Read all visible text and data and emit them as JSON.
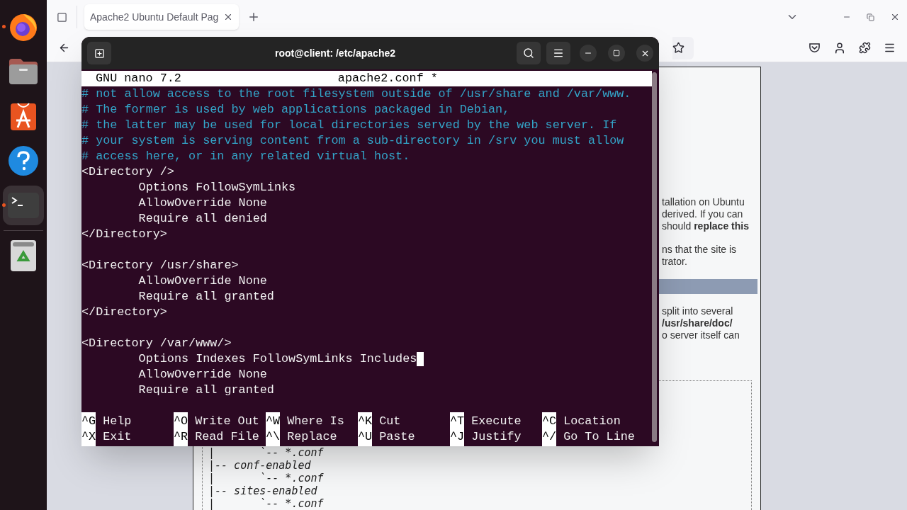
{
  "browser": {
    "tab": {
      "title": "Apache2 Ubuntu Default Pag",
      "selected": true
    },
    "page_lines": [
      {
        "kind": "text",
        "text": "tallation on Ubuntu"
      },
      {
        "kind": "text",
        "text": "derived. If you can"
      },
      {
        "kind": "text",
        "text": "should **replace this**"
      },
      {
        "kind": "gap"
      },
      {
        "kind": "text",
        "text": "ns that the site is"
      },
      {
        "kind": "text",
        "text": "trator."
      },
      {
        "kind": "gap"
      },
      {
        "kind": "bar"
      },
      {
        "kind": "gap"
      },
      {
        "kind": "text",
        "text": "split into several"
      },
      {
        "kind": "text",
        "text": "**/usr/share/doc/**"
      },
      {
        "kind": "text",
        "text": "o server itself can"
      }
    ],
    "tree": [
      "|       `-- *.conf",
      "|-- conf-enabled",
      "|       `-- *.conf",
      "|-- sites-enabled",
      "|       `-- *.conf"
    ]
  },
  "terminal": {
    "title": "root@client: /etc/apache2",
    "editor": "GNU nano 7.2",
    "file": "apache2.conf *",
    "lines": [
      {
        "kind": "comment",
        "text": "# not allow access to the root filesystem outside of /usr/share and /var/www.",
        "cursor": false
      },
      {
        "kind": "comment",
        "text": "# The former is used by web applications packaged in Debian,",
        "cursor": false
      },
      {
        "kind": "comment",
        "text": "# the latter may be used for local directories served by the web server. If",
        "cursor": false
      },
      {
        "kind": "comment",
        "text": "# your system is serving content from a sub-directory in /srv you must allow",
        "cursor": false
      },
      {
        "kind": "comment",
        "text": "# access here, or in any related virtual host.",
        "cursor": false
      },
      {
        "kind": "code",
        "text": "<Directory />",
        "cursor": false
      },
      {
        "kind": "code",
        "text": "\tOptions FollowSymLinks",
        "cursor": false
      },
      {
        "kind": "code",
        "text": "\tAllowOverride None",
        "cursor": false
      },
      {
        "kind": "code",
        "text": "\tRequire all denied",
        "cursor": false
      },
      {
        "kind": "code",
        "text": "</Directory>",
        "cursor": false
      },
      {
        "kind": "blank"
      },
      {
        "kind": "code",
        "text": "<Directory /usr/share>",
        "cursor": false
      },
      {
        "kind": "code",
        "text": "\tAllowOverride None",
        "cursor": false
      },
      {
        "kind": "code",
        "text": "\tRequire all granted",
        "cursor": false
      },
      {
        "kind": "code",
        "text": "</Directory>",
        "cursor": false
      },
      {
        "kind": "blank"
      },
      {
        "kind": "code",
        "text": "<Directory /var/www/>",
        "cursor": false
      },
      {
        "kind": "code",
        "text": "\tOptions Indexes FollowSymLinks Includes",
        "cursor": true
      },
      {
        "kind": "code",
        "text": "\tAllowOverride None",
        "cursor": false
      },
      {
        "kind": "code",
        "text": "\tRequire all granted",
        "cursor": false
      }
    ],
    "shortcuts": [
      [
        {
          "key": "^G",
          "label": "Help"
        },
        {
          "key": "^O",
          "label": "Write Out"
        },
        {
          "key": "^W",
          "label": "Where Is"
        },
        {
          "key": "^K",
          "label": "Cut"
        },
        {
          "key": "^T",
          "label": "Execute"
        },
        {
          "key": "^C",
          "label": "Location"
        }
      ],
      [
        {
          "key": "^X",
          "label": "Exit"
        },
        {
          "key": "^R",
          "label": "Read File"
        },
        {
          "key": "^\\",
          "label": "Replace"
        },
        {
          "key": "^U",
          "label": "Paste"
        },
        {
          "key": "^J",
          "label": "Justify"
        },
        {
          "key": "^/",
          "label": "Go To Line"
        }
      ]
    ]
  },
  "dock": [
    {
      "kind": "firefox",
      "running": true,
      "selected": false
    },
    {
      "kind": "files",
      "running": false,
      "selected": false
    },
    {
      "kind": "store",
      "running": false,
      "selected": false
    },
    {
      "kind": "help",
      "running": false,
      "selected": false
    },
    {
      "kind": "terminal",
      "running": true,
      "selected": true
    },
    {
      "kind": "trash",
      "running": false,
      "selected": false
    }
  ]
}
